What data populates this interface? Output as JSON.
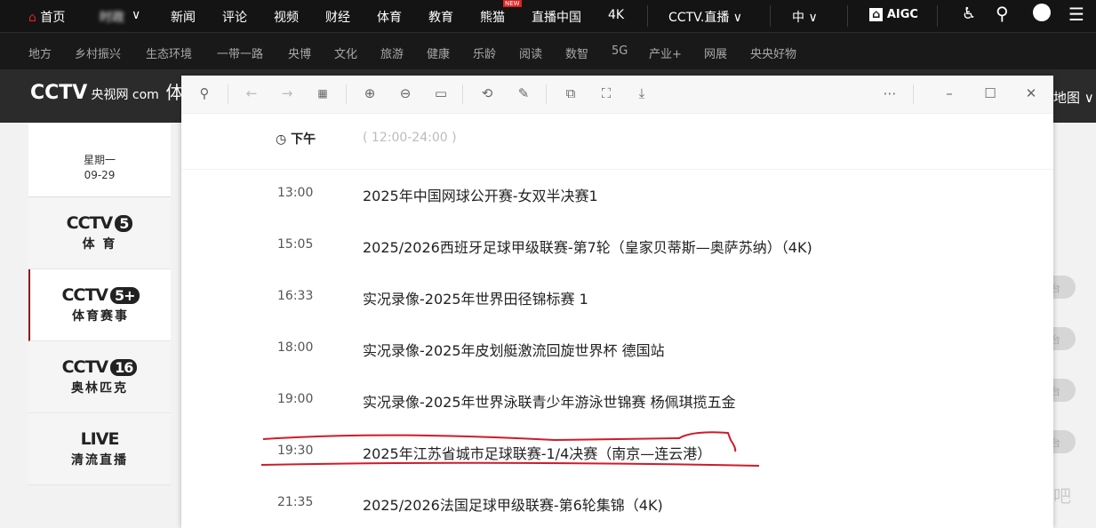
{
  "topnav": {
    "home": "首页",
    "item2": "时政",
    "items": [
      "新闻",
      "评论",
      "视频",
      "财经",
      "体育",
      "教育",
      "熊猫",
      "直播中国",
      "4K"
    ],
    "new_badge": "NEW",
    "cctv_live": "CCTV.直播",
    "lang": "中",
    "aigc": "AIGC"
  },
  "subnav": [
    "地方",
    "乡村振兴",
    "生态环境",
    "一带一路",
    "央博",
    "文化",
    "旅游",
    "健康",
    "乐龄",
    "阅读",
    "数智",
    "5G",
    "产业+",
    "网展",
    "央央好物"
  ],
  "header": {
    "logo": "CCTV",
    "logo_com": "央视网 com",
    "logo_section": "体育",
    "map": "地图"
  },
  "sidebar": {
    "weekday": "星期一",
    "date": "09-29",
    "channels": [
      {
        "logo": "CCTV",
        "num": "5",
        "sub": "体 育"
      },
      {
        "logo": "CCTV",
        "num": "5+",
        "sub": "体育赛事"
      },
      {
        "logo": "CCTV",
        "num": "16",
        "sub": "奥林匹克"
      },
      {
        "logo": "LIVE",
        "num": "",
        "sub": "清流直播"
      }
    ]
  },
  "right_pills": [
    "台",
    "台",
    "台",
    "台"
  ],
  "right_partial": "吧",
  "schedule": {
    "period": "下午",
    "range": "( 12:00-24:00 )",
    "rows": [
      {
        "time": "13:00",
        "title": "2025年中国网球公开赛-女双半决赛1"
      },
      {
        "time": "15:05",
        "title": "2025/2026西班牙足球甲级联赛-第7轮（皇家贝蒂斯—奥萨苏纳）（4K)"
      },
      {
        "time": "16:33",
        "title": "实况录像-2025年世界田径锦标赛 1"
      },
      {
        "time": "18:00",
        "title": "实况录像-2025年皮划艇激流回旋世界杯 德国站"
      },
      {
        "time": "19:00",
        "title": "实况录像-2025年世界泳联青少年游泳世锦赛 杨佩琪揽五金"
      },
      {
        "time": "19:30",
        "title": "2025年江苏省城市足球联赛-1/4决赛（南京—连云港）",
        "highlighted": true
      },
      {
        "time": "21:35",
        "title": "2025/2026法国足球甲级联赛-第6轮集锦（4K)"
      }
    ]
  },
  "colors": {
    "annotation": "#d11a2a",
    "accent": "#8b1a1a"
  }
}
